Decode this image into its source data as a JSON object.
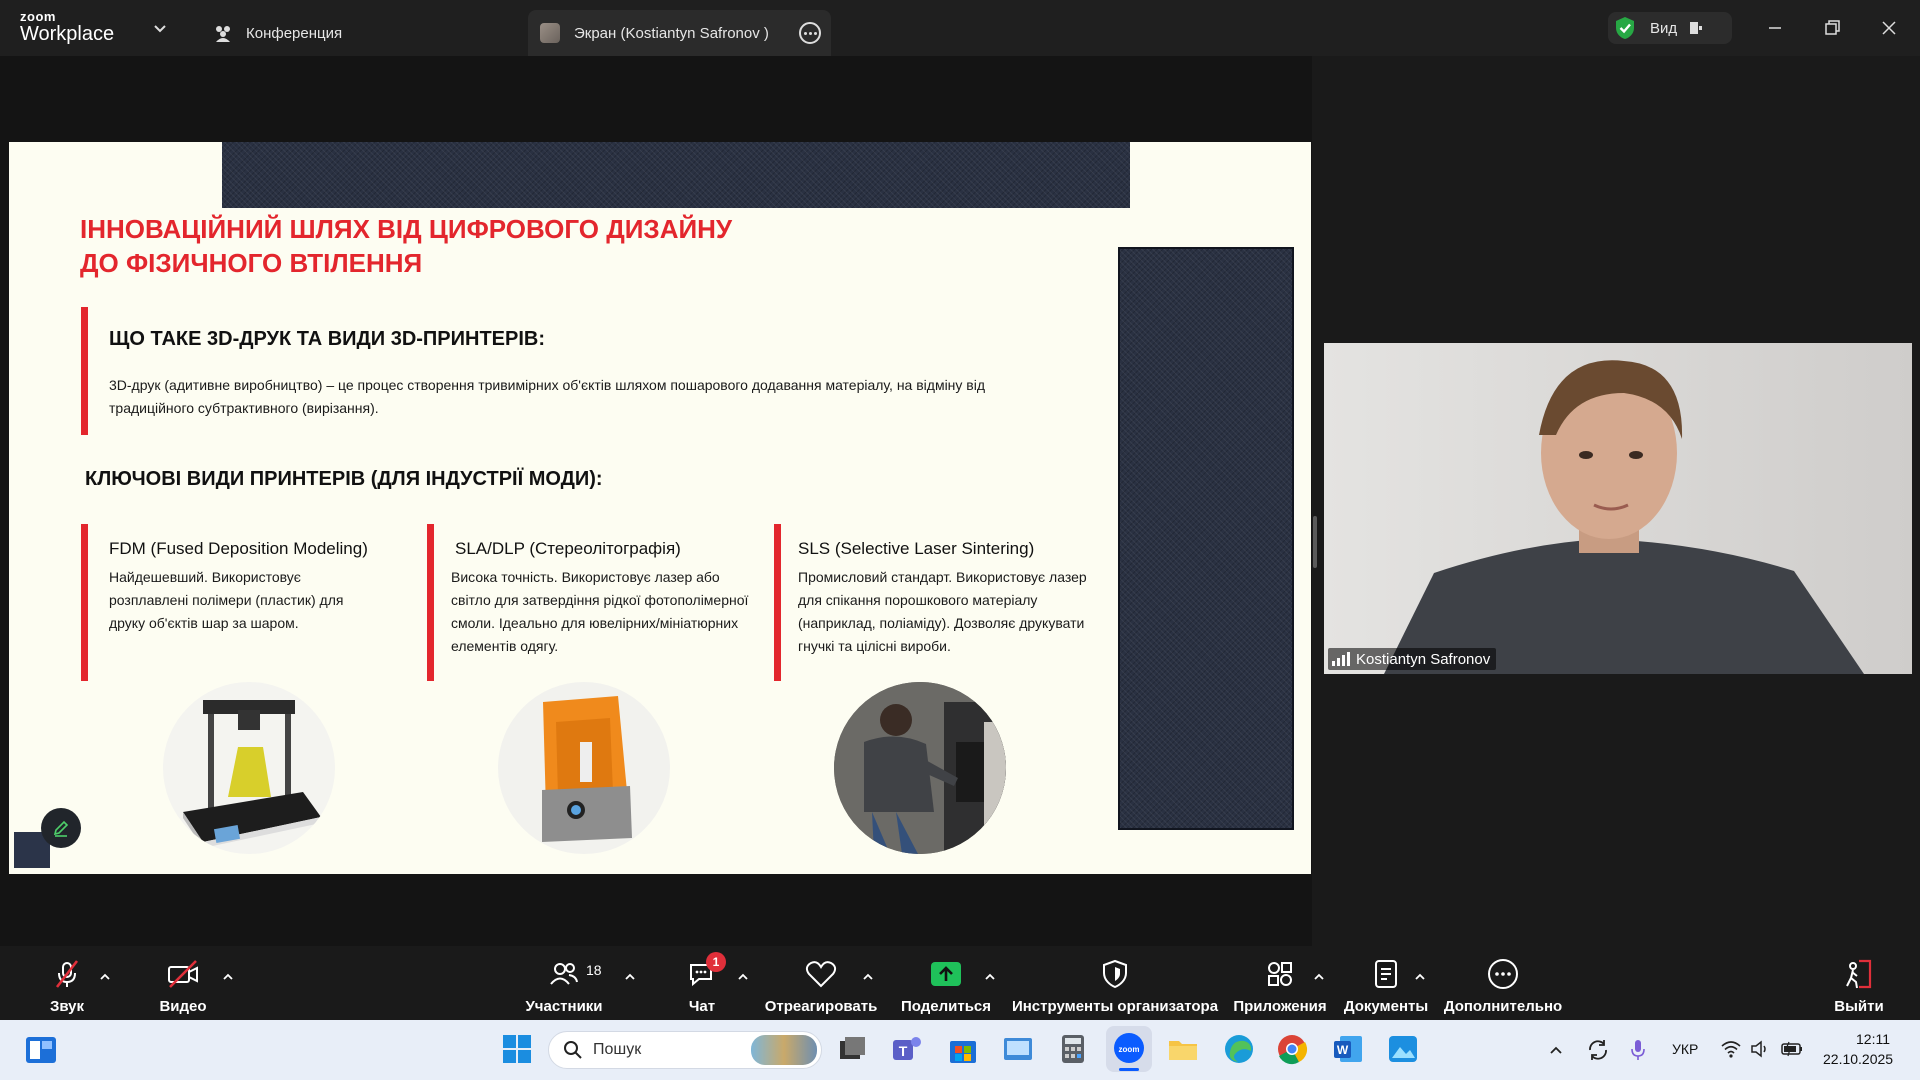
{
  "app": {
    "brand_small": "zoom",
    "brand_large": "Workplace",
    "tab_conference": "Конференция",
    "tab_screen": "Экран (Kostiantyn Safronov )",
    "view_label": "Вид",
    "accent_green": "#27a844"
  },
  "slide": {
    "title_line1": "ІННОВАЦІЙНИЙ ШЛЯХ ВІД ЦИФРОВОГО ДИЗАЙНУ",
    "title_line2": "ДО ФІЗИЧНОГО ВТІЛЕННЯ",
    "section1_heading": "ЩО ТАКЕ 3D-ДРУК ТА ВИДИ 3D-ПРИНТЕРІВ:",
    "section1_text": "3D-друк (адитивне виробництво) – це процес створення тривимірних об'єктів шляхом пошарового додавання матеріалу, на відміну від традиційного субтрактивного (вирізання).",
    "section2_heading": "КЛЮЧОВІ ВИДИ ПРИНТЕРІВ (ДЛЯ ІНДУСТРІЇ МОДИ):",
    "columns": [
      {
        "title": "FDM (Fused Deposition Modeling)",
        "text": "Найдешевший. Використовує розплавлені полімери (пластик) для друку об'єктів шар за шаром."
      },
      {
        "title": "SLA/DLP (Стереолітографія)",
        "text": "Висока точність. Використовує лазер або світло для затвердіння рідкої фотополімерної смоли. Ідеально для ювелірних/мініатюрних елементів одягу."
      },
      {
        "title": "SLS (Selective Laser Sintering)",
        "text": "Промисловий стандарт. Використовує лазер для спікання порошкового матеріалу (наприклад, поліаміду). Дозволяє друкувати гнучкі та цілісні вироби."
      }
    ],
    "accent_red": "#e3262d"
  },
  "video": {
    "participant_name": "Kostiantyn Safronov"
  },
  "toolbar": {
    "audio": "Звук",
    "video": "Видео",
    "participants": "Участники",
    "participants_count": "18",
    "chat": "Чат",
    "chat_badge": "1",
    "react": "Отреагировать",
    "share": "Поделиться",
    "host_tools": "Инструменты организатора",
    "apps": "Приложения",
    "docs": "Документы",
    "more": "Дополнительно",
    "leave": "Выйти"
  },
  "taskbar": {
    "search_placeholder": "Пошук",
    "language": "УКР",
    "time": "12:11",
    "date": "22.10.2025"
  }
}
